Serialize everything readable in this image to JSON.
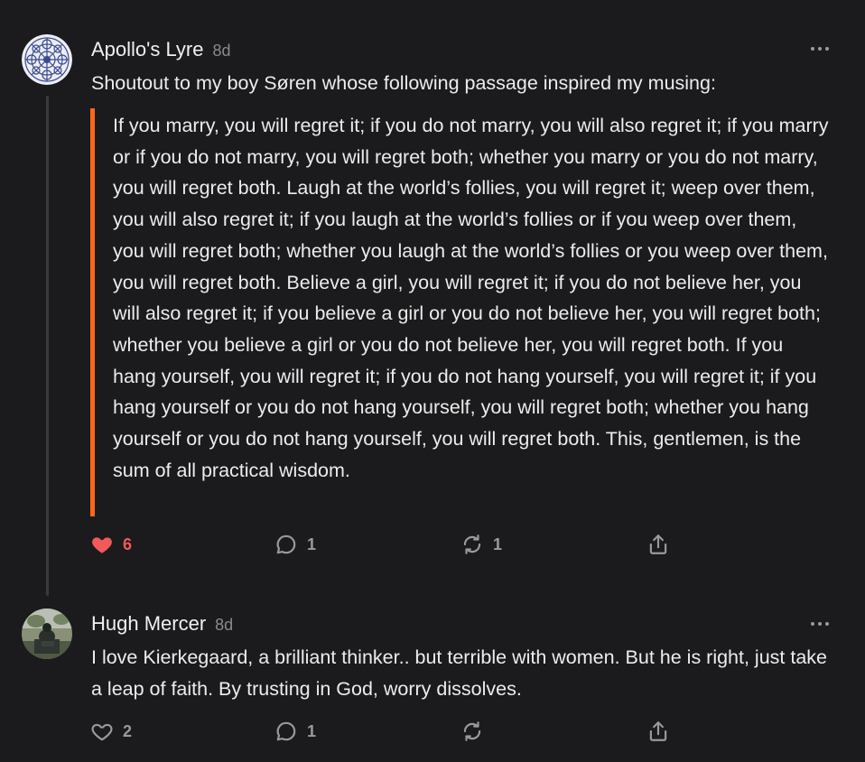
{
  "comments": [
    {
      "author": "Apollo's Lyre",
      "age": "8d",
      "text": "Shoutout to my boy Søren whose following passage inspired my musing:",
      "quote": "If you marry, you will regret it; if you do not marry, you will also regret it; if you marry or if you do not marry, you will regret both; whether you marry or you do not marry, you will regret both. Laugh at the world’s follies, you will regret it; weep over them, you will also regret it; if you laugh at the world’s follies or if you weep over them, you will regret both; whether you laugh at the world’s follies or you weep over them, you will regret both. Believe a girl, you will regret it; if you do not believe her, you will also regret it; if you believe a girl or you do not believe her, you will regret both; whether you believe a girl or you do not believe her, you will regret both. If you hang yourself, you will regret it; if you do not hang yourself, you will regret it; if you hang yourself or you do not hang yourself, you will regret both; whether you hang yourself or you do not hang yourself, you will regret both. This, gentlemen, is the sum of all practical wisdom.",
      "likes": "6",
      "liked": true,
      "replies": "1",
      "restacks": "1",
      "avatar_icon": "mandala-avatar-icon"
    },
    {
      "author": "Hugh Mercer",
      "age": "8d",
      "text": "I love Kierkegaard, a brilliant thinker.. but terrible with women. But he is right, just take a leap of faith. By trusting in God, worry dissolves.",
      "likes": "2",
      "liked": false,
      "replies": "1",
      "restacks": "",
      "avatar_icon": "statue-photo-avatar"
    }
  ],
  "icons": {
    "like": "heart-icon",
    "reply": "comment-bubble-icon",
    "restack": "restack-arrows-icon",
    "share": "share-icon",
    "more": "more-dots-icon"
  },
  "colors": {
    "background": "#1b1b1d",
    "accent": "#ff6719",
    "liked": "#f25a5a",
    "muted": "#9a9a9e"
  }
}
